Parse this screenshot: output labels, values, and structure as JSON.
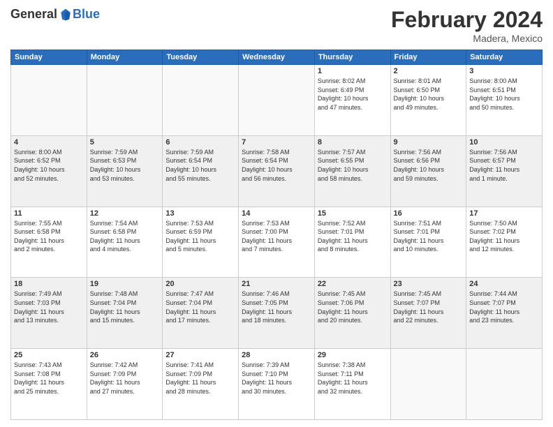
{
  "header": {
    "logo_general": "General",
    "logo_blue": "Blue",
    "title": "February 2024",
    "location": "Madera, Mexico"
  },
  "days_of_week": [
    "Sunday",
    "Monday",
    "Tuesday",
    "Wednesday",
    "Thursday",
    "Friday",
    "Saturday"
  ],
  "weeks": [
    [
      {
        "day": "",
        "info": ""
      },
      {
        "day": "",
        "info": ""
      },
      {
        "day": "",
        "info": ""
      },
      {
        "day": "",
        "info": ""
      },
      {
        "day": "1",
        "info": "Sunrise: 8:02 AM\nSunset: 6:49 PM\nDaylight: 10 hours\nand 47 minutes."
      },
      {
        "day": "2",
        "info": "Sunrise: 8:01 AM\nSunset: 6:50 PM\nDaylight: 10 hours\nand 49 minutes."
      },
      {
        "day": "3",
        "info": "Sunrise: 8:00 AM\nSunset: 6:51 PM\nDaylight: 10 hours\nand 50 minutes."
      }
    ],
    [
      {
        "day": "4",
        "info": "Sunrise: 8:00 AM\nSunset: 6:52 PM\nDaylight: 10 hours\nand 52 minutes."
      },
      {
        "day": "5",
        "info": "Sunrise: 7:59 AM\nSunset: 6:53 PM\nDaylight: 10 hours\nand 53 minutes."
      },
      {
        "day": "6",
        "info": "Sunrise: 7:59 AM\nSunset: 6:54 PM\nDaylight: 10 hours\nand 55 minutes."
      },
      {
        "day": "7",
        "info": "Sunrise: 7:58 AM\nSunset: 6:54 PM\nDaylight: 10 hours\nand 56 minutes."
      },
      {
        "day": "8",
        "info": "Sunrise: 7:57 AM\nSunset: 6:55 PM\nDaylight: 10 hours\nand 58 minutes."
      },
      {
        "day": "9",
        "info": "Sunrise: 7:56 AM\nSunset: 6:56 PM\nDaylight: 10 hours\nand 59 minutes."
      },
      {
        "day": "10",
        "info": "Sunrise: 7:56 AM\nSunset: 6:57 PM\nDaylight: 11 hours\nand 1 minute."
      }
    ],
    [
      {
        "day": "11",
        "info": "Sunrise: 7:55 AM\nSunset: 6:58 PM\nDaylight: 11 hours\nand 2 minutes."
      },
      {
        "day": "12",
        "info": "Sunrise: 7:54 AM\nSunset: 6:58 PM\nDaylight: 11 hours\nand 4 minutes."
      },
      {
        "day": "13",
        "info": "Sunrise: 7:53 AM\nSunset: 6:59 PM\nDaylight: 11 hours\nand 5 minutes."
      },
      {
        "day": "14",
        "info": "Sunrise: 7:53 AM\nSunset: 7:00 PM\nDaylight: 11 hours\nand 7 minutes."
      },
      {
        "day": "15",
        "info": "Sunrise: 7:52 AM\nSunset: 7:01 PM\nDaylight: 11 hours\nand 8 minutes."
      },
      {
        "day": "16",
        "info": "Sunrise: 7:51 AM\nSunset: 7:01 PM\nDaylight: 11 hours\nand 10 minutes."
      },
      {
        "day": "17",
        "info": "Sunrise: 7:50 AM\nSunset: 7:02 PM\nDaylight: 11 hours\nand 12 minutes."
      }
    ],
    [
      {
        "day": "18",
        "info": "Sunrise: 7:49 AM\nSunset: 7:03 PM\nDaylight: 11 hours\nand 13 minutes."
      },
      {
        "day": "19",
        "info": "Sunrise: 7:48 AM\nSunset: 7:04 PM\nDaylight: 11 hours\nand 15 minutes."
      },
      {
        "day": "20",
        "info": "Sunrise: 7:47 AM\nSunset: 7:04 PM\nDaylight: 11 hours\nand 17 minutes."
      },
      {
        "day": "21",
        "info": "Sunrise: 7:46 AM\nSunset: 7:05 PM\nDaylight: 11 hours\nand 18 minutes."
      },
      {
        "day": "22",
        "info": "Sunrise: 7:45 AM\nSunset: 7:06 PM\nDaylight: 11 hours\nand 20 minutes."
      },
      {
        "day": "23",
        "info": "Sunrise: 7:45 AM\nSunset: 7:07 PM\nDaylight: 11 hours\nand 22 minutes."
      },
      {
        "day": "24",
        "info": "Sunrise: 7:44 AM\nSunset: 7:07 PM\nDaylight: 11 hours\nand 23 minutes."
      }
    ],
    [
      {
        "day": "25",
        "info": "Sunrise: 7:43 AM\nSunset: 7:08 PM\nDaylight: 11 hours\nand 25 minutes."
      },
      {
        "day": "26",
        "info": "Sunrise: 7:42 AM\nSunset: 7:09 PM\nDaylight: 11 hours\nand 27 minutes."
      },
      {
        "day": "27",
        "info": "Sunrise: 7:41 AM\nSunset: 7:09 PM\nDaylight: 11 hours\nand 28 minutes."
      },
      {
        "day": "28",
        "info": "Sunrise: 7:39 AM\nSunset: 7:10 PM\nDaylight: 11 hours\nand 30 minutes."
      },
      {
        "day": "29",
        "info": "Sunrise: 7:38 AM\nSunset: 7:11 PM\nDaylight: 11 hours\nand 32 minutes."
      },
      {
        "day": "",
        "info": ""
      },
      {
        "day": "",
        "info": ""
      }
    ]
  ]
}
